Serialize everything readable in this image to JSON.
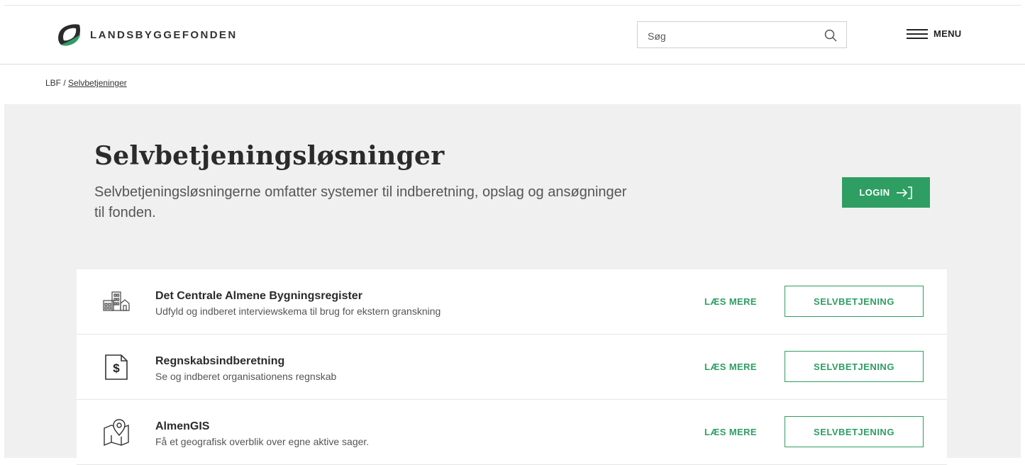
{
  "header": {
    "logo_text": "LANDSBYGGEFONDEN",
    "search_placeholder": "Søg",
    "menu_label": "MENU"
  },
  "breadcrumb": {
    "root": "LBF",
    "separator": " / ",
    "current": "Selvbetjeninger"
  },
  "hero": {
    "title": "Selvbetjeningsløsninger",
    "subtitle": "Selvbetjeningsløsningerne omfatter systemer til indberetning, opslag og ansøgninger til fonden.",
    "login_label": "LOGIN"
  },
  "services": [
    {
      "title": "Det Centrale Almene Bygningsregister",
      "description": "Udfyld og indberet interviewskema til brug for ekstern granskning",
      "read_more": "LÆS MERE",
      "action": "SELVBETJENING",
      "icon": "buildings-icon"
    },
    {
      "title": "Regnskabsindberetning",
      "description": "Se og indberet organisationens regnskab",
      "read_more": "LÆS MERE",
      "action": "SELVBETJENING",
      "icon": "dollar-document-icon"
    },
    {
      "title": "AlmenGIS",
      "description": "Få et geografisk overblik over egne aktive sager.",
      "read_more": "LÆS MERE",
      "action": "SELVBETJENING",
      "icon": "map-pin-icon"
    }
  ],
  "colors": {
    "brand_green": "#2e9e63",
    "hero_background": "#f0f0f0",
    "text_dark": "#2b2b2b"
  }
}
